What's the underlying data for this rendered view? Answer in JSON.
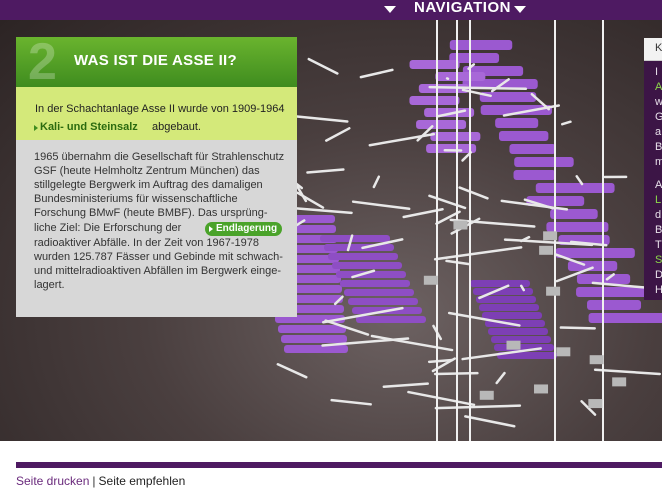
{
  "navigation": {
    "label": "NAVIGATION"
  },
  "panel": {
    "number": "2",
    "title": "WAS IST DIE ASSE II?",
    "intro_text": "In der Schachtanlage Asse II wurde von 1909-1964",
    "intro_link": "Kali- und Steinsalz",
    "intro_suffix": "abgebaut.",
    "body_lines": [
      "1965 übernahm die Gesellschaft für Strahlenschutz",
      "GSF (heute Helmholtz Zentrum München) das",
      "stillgelegte Bergwerk im Auftrag des damaligen",
      "Bundesministeriums für wissenschaftliche",
      "Forschung BMwF (heute BMBF). Das ursprüng-",
      "liche Ziel: Die Erforschung der",
      "radioaktiver Abfälle. In der Zeit von 1967-1978",
      "wurden 125.787 Fässer und Gebinde mit schwach-",
      "und mittelradioaktiven Abfällen im Bergwerk einge-",
      "lagert."
    ],
    "endlager_link": "Endlagerung"
  },
  "side_panel": {
    "head": "K",
    "chars": [
      "I",
      "A",
      "w",
      "G",
      "a",
      "B",
      "m",
      "A",
      "L",
      "d",
      "B",
      "T",
      "S",
      "D",
      "H"
    ]
  },
  "footer": {
    "print_link": "Seite drucken",
    "separator": "|",
    "recommend_link": "Seite empfehlen"
  },
  "colors": {
    "purple_brand": "#4e1a62",
    "green_header": "#3f8c1f",
    "green_light": "#d4e97a",
    "mine_purple": "#9b59d0"
  }
}
